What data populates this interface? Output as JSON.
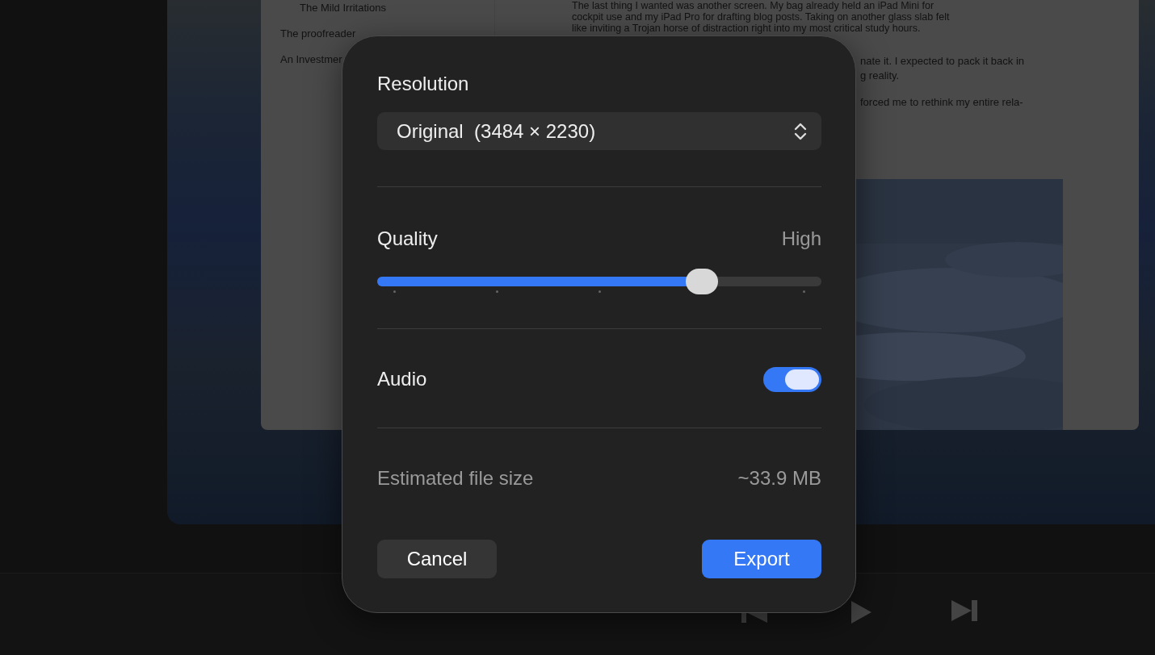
{
  "background": {
    "sidebar_items": [
      "The Mild Irritations",
      "The proofreader",
      "An Investmer"
    ],
    "article_lines": [
      "The last thing I wanted was another screen. My bag already held an iPad Mini for",
      "cockpit use and my iPad Pro for drafting blog posts. Taking on another glass slab felt",
      "like inviting a Trojan horse of distraction right into my most critical study hours."
    ],
    "article_fragments": [
      "nate it. I expected to pack it back in",
      "g reality.",
      "forced me to rethink my entire rela-"
    ]
  },
  "dialog": {
    "resolution": {
      "label": "Resolution",
      "value": "Original  (3484 × 2230)"
    },
    "quality": {
      "label": "Quality",
      "reading": "High",
      "level": 0.73
    },
    "audio": {
      "label": "Audio",
      "on": true
    },
    "file_size": {
      "label": "Estimated file size",
      "value": "~33.9 MB"
    },
    "buttons": [
      {
        "label": "Cancel",
        "kind": "secondary"
      },
      {
        "label": "Export",
        "kind": "primary"
      }
    ]
  }
}
